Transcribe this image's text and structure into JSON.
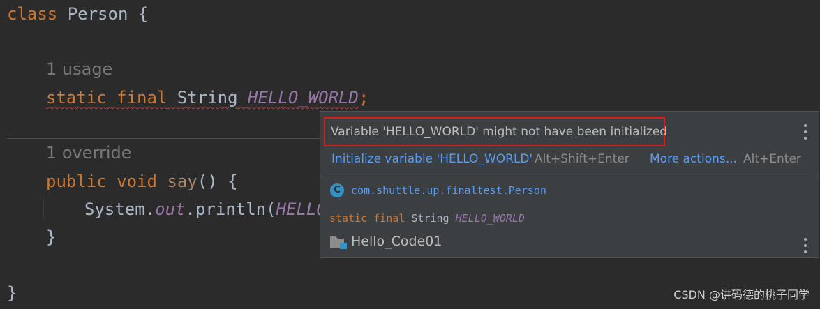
{
  "editor": {
    "line_class": {
      "kw": "class",
      "name": " Person {"
    },
    "hint_usage": "1 usage",
    "line_field": {
      "kw1": "static",
      "kw2": "final",
      "type": "String",
      "name": "HELLO_WORLD",
      "semi": ";"
    },
    "hint_override": "1 override",
    "line_method": {
      "kw1": "public",
      "kw2": "void",
      "fn": "say",
      "rest": "() {"
    },
    "line_print": {
      "prefix": "System.",
      "field": "out",
      "mid": ".println(",
      "arg": "HELLO_"
    },
    "line_close_method": "}",
    "line_close_class": "}"
  },
  "popup": {
    "error_message": "Variable 'HELLO_WORLD' might not have been initialized",
    "quick_fix": "Initialize variable 'HELLO_WORLD'",
    "quick_fix_shortcut": "Alt+Shift+Enter",
    "more_actions": "More actions...",
    "more_actions_shortcut": "Alt+Enter",
    "class_icon_letter": "C",
    "qualified_name": "com.shuttle.up.finaltest.Person",
    "declaration": {
      "kw": "static final",
      "type": "String",
      "name": "HELLO_WORLD"
    },
    "module": "Hello_Code01"
  },
  "watermark": "CSDN @讲码德的桃子同学",
  "colors": {
    "background": "#2b2b2b",
    "keyword": "#cc7832",
    "field": "#9876aa",
    "link": "#589df6",
    "error_border": "#d61f1f"
  },
  "icons": [
    "more-vertical-icon",
    "class-icon",
    "module-folder-icon"
  ]
}
